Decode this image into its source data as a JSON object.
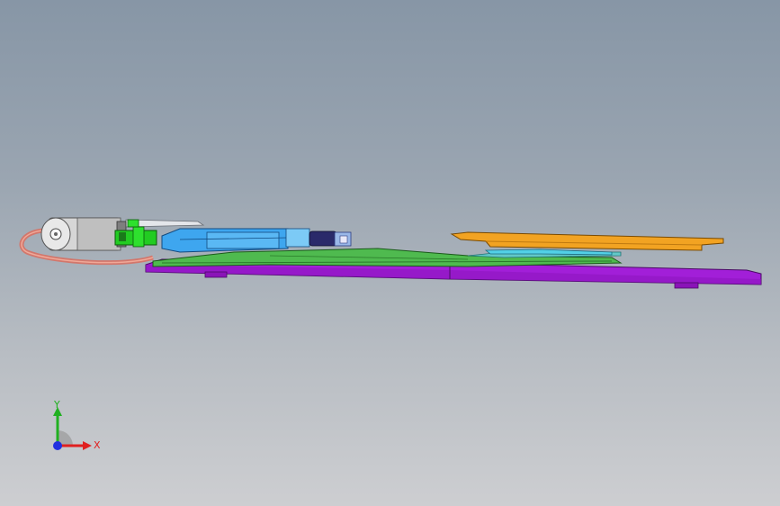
{
  "triad": {
    "x_label": "X",
    "y_label": "Y",
    "x_color": "#e02020",
    "y_color": "#20b020",
    "z_color": "#2030e0"
  },
  "colors": {
    "background_top": "#8796a6",
    "background_bottom": "#cdced1",
    "base_plate": "#a020d8",
    "top_plate": "#f0a020",
    "pcb": "#4ab84a",
    "housing": "#40a8f0",
    "connector": "#20d020",
    "cable": "#d87a70",
    "motor": "#d8d8d8"
  }
}
